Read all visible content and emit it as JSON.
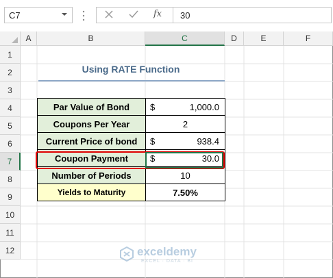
{
  "formula_bar": {
    "name_box": "C7",
    "fx": "fx",
    "formula": "30"
  },
  "columns": [
    "A",
    "B",
    "C",
    "D",
    "E",
    "F"
  ],
  "rows": [
    "1",
    "2",
    "3",
    "4",
    "5",
    "6",
    "7",
    "8",
    "9",
    "10",
    "11",
    "12"
  ],
  "title": "Using RATE Function",
  "table": [
    {
      "label": "Par Value of Bond",
      "dollar": "$",
      "value": "1,000.0"
    },
    {
      "label": "Coupons Per Year",
      "dollar": "",
      "value": "2"
    },
    {
      "label": "Current Price of bond",
      "dollar": "$",
      "value": "938.4"
    },
    {
      "label": "Coupon Payment",
      "dollar": "$",
      "value": "30.0"
    },
    {
      "label": "Number of Periods",
      "dollar": "",
      "value": "10"
    },
    {
      "label": "Yields to Maturity",
      "dollar": "",
      "value": "7.50%"
    }
  ],
  "watermark": {
    "name": "exceldemy",
    "tagline": "EXCEL · DATA · BI"
  },
  "colors": {
    "accent": "#217346",
    "highlight": "#e00000",
    "label_fill": "#e2efda",
    "yield_fill": "#ffffcc"
  }
}
